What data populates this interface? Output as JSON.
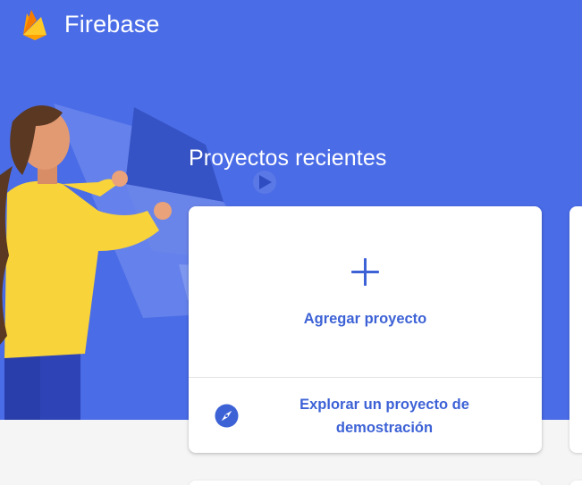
{
  "header": {
    "brand_name": "Firebase",
    "logo_icon": "firebase-flame-icon"
  },
  "main": {
    "section_title": "Proyectos recientes",
    "add_project": {
      "icon": "plus-icon",
      "label": "Agregar proyecto"
    },
    "demo_project": {
      "icon": "compass-icon",
      "label": "Explorar un proyecto de demostración"
    }
  },
  "colors": {
    "hero_background": "#4a6ce7",
    "accent": "#3d62d6",
    "page_background": "#f5f5f5",
    "flame_yellow": "#ffca28",
    "flame_orange": "#ffa000"
  }
}
